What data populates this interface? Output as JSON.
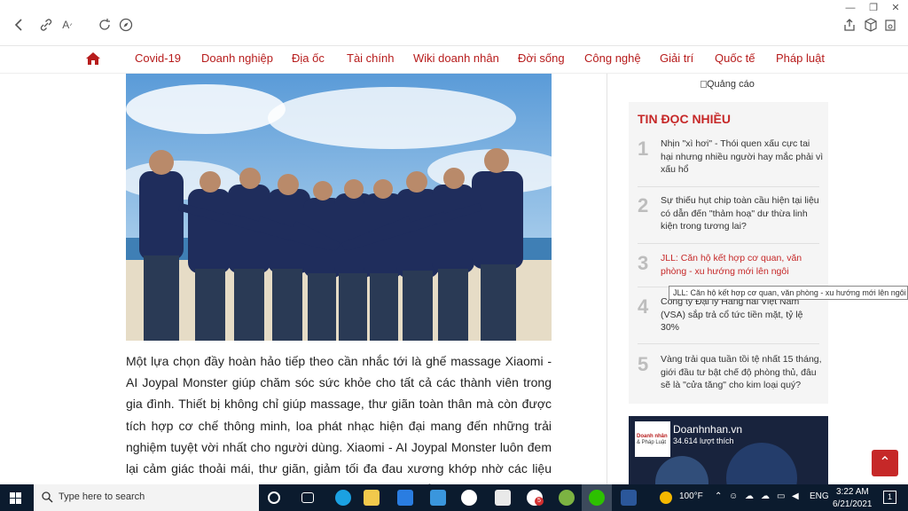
{
  "nav": {
    "items": [
      "Covid-19",
      "Doanh nghiệp",
      "Địa ốc",
      "Tài chính",
      "Wiki doanh nhân",
      "Đời sống",
      "Công nghệ",
      "Giải trí",
      "Quốc tế",
      "Pháp luật"
    ]
  },
  "article": {
    "paragraph": "Một lựa chọn đầy hoàn hảo tiếp theo cần nhắc tới là ghế massage Xiaomi - AI Joypal Monster giúp chăm sóc sức khỏe cho tất cả các thành viên trong gia đình. Thiết bị không chỉ giúp massage, thư giãn toàn thân mà còn được tích hợp cơ chế thông minh, loa phát nhạc hiện đại mang đến những trải nghiệm tuyệt vời nhất cho người dùng. Xiaomi - AI Joypal Monster luôn đem lại cảm giác thoải mái, thư giãn, giảm tối đa đau xương khớp nhờ các liệu trình thông minh được tích hợp trong cùng một sản phẩm đa năng này."
  },
  "sidebar": {
    "ad_alt": "Quảng cáo",
    "most_read_title": "TIN ĐỌC NHIỀU",
    "items": [
      {
        "num": "1",
        "text": "Nhịn \"xì hơi\" - Thói quen xấu cực tai hại nhưng nhiều người hay mắc phải vì xấu hổ"
      },
      {
        "num": "2",
        "text": "Sự thiếu hụt chip toàn cầu hiện tại liệu có dẫn đến \"thảm hoạ\" dư thừa linh kiện trong tương lai?"
      },
      {
        "num": "3",
        "text": "JLL: Căn hộ kết hợp cơ quan, văn phòng - xu hướng mới lên ngôi"
      },
      {
        "num": "4",
        "text": "Công ty Đại lý Hàng hải Việt Nam (VSA) sắp trả cổ tức tiền mặt, tỷ lệ 30%"
      },
      {
        "num": "5",
        "text": "Vàng trải qua tuần tồi tệ nhất 15 tháng, giới đầu tư bật chế độ phòng thủ, đâu sẽ là \"cửa tăng\" cho kim loại quý?"
      }
    ],
    "tooltip": "JLL: Căn hộ kết hợp cơ quan, văn phòng - xu hướng mới lên ngôi",
    "fb": {
      "page_name": "Doanhnhan.vn",
      "likes": "34.614 lượt thích",
      "logo_line1": "Doanh nhân",
      "logo_line2": "& Pháp Luật"
    }
  },
  "taskbar": {
    "search_placeholder": "Type here to search",
    "weather": "100°F",
    "lang": "ENG",
    "time": "3:22 AM",
    "date": "6/21/2021",
    "notif_count": "1",
    "mail_badge": "5"
  },
  "colors": {
    "accent": "#b71c1c",
    "taskbar": "#0b1b2e"
  }
}
